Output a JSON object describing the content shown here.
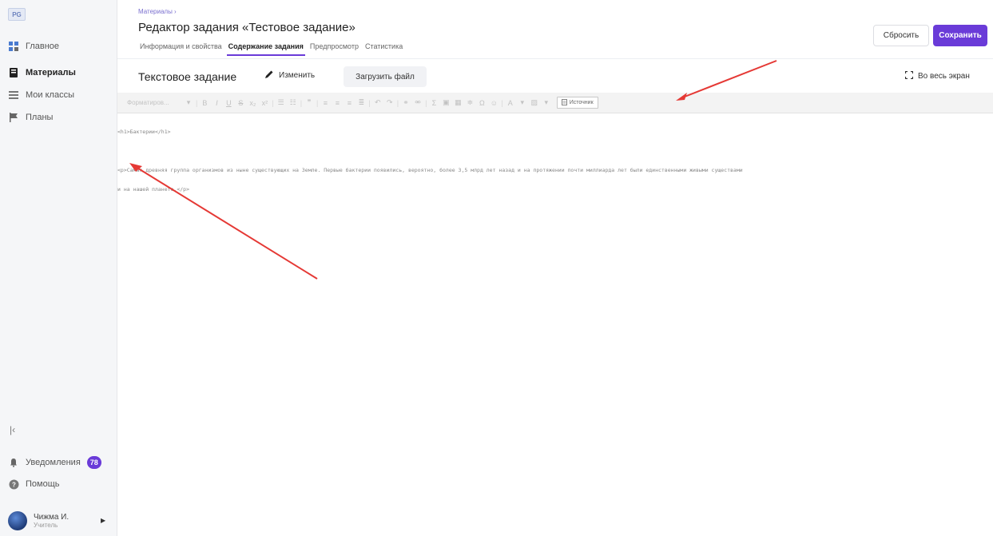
{
  "sidebar": {
    "logo": "PG",
    "items": [
      {
        "label": "Главное",
        "icon": "grid-icon"
      },
      {
        "label": "Материалы",
        "icon": "book-icon"
      },
      {
        "label": "Мои классы",
        "icon": "table-icon"
      },
      {
        "label": "Планы",
        "icon": "flag-icon"
      }
    ],
    "notifications_label": "Уведомления",
    "notifications_count": "78",
    "help_label": "Помощь",
    "user_name": "Чижма И.",
    "user_role": "Учитель"
  },
  "header": {
    "breadcrumb": "Материалы ›",
    "title": "Редактор задания «Тестовое задание»",
    "tabs": [
      {
        "label": "Информация и свойства"
      },
      {
        "label": "Содержание задания"
      },
      {
        "label": "Предпросмотр"
      },
      {
        "label": "Статистика"
      }
    ],
    "reset_label": "Сбросить",
    "save_label": "Сохранить"
  },
  "editor": {
    "title": "Текстовое задание",
    "edit_label": "Изменить",
    "upload_label": "Загрузить файл",
    "fullscreen_label": "Во весь экран",
    "format_placeholder": "Форматиров...",
    "source_label": "Источник",
    "code_lines": [
      "<h1>Бактерии</h1>",
      "",
      "<p>Самая древняя группа организмов из ныне существующих на Земле. Первые бактерии появились, вероятно, более 3,5 млрд лет назад и на протяжении почти миллиарда лет были единственными живыми существами",
      "и на нашей планете.</p>"
    ]
  },
  "colors": {
    "accent": "#6a3bd8",
    "arrow": "#e53935"
  }
}
